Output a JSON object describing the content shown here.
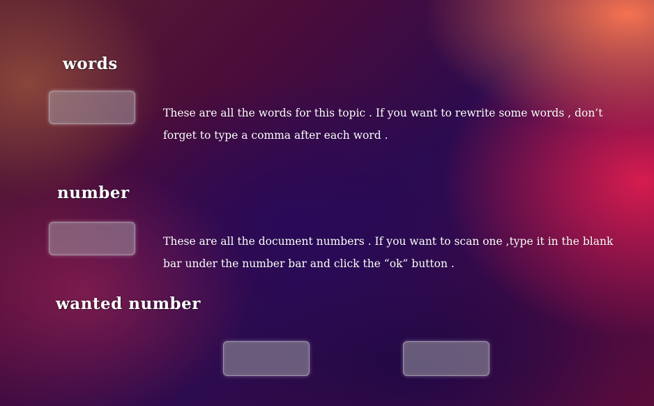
{
  "sections": {
    "words": {
      "heading": "words",
      "input_value": "",
      "description": "These are all the words for this topic . If you want to rewrite some words , don’t forget to type a comma after each word ."
    },
    "number": {
      "heading": "number",
      "input_value": "",
      "description": "These are all the document numbers . If you want to scan one ,type it in the blank bar under the number bar and click the “ok” button ."
    },
    "wanted_number": {
      "heading": "wanted number",
      "input_value": ""
    }
  },
  "buttons": {
    "left_label": "",
    "right_label": ""
  }
}
